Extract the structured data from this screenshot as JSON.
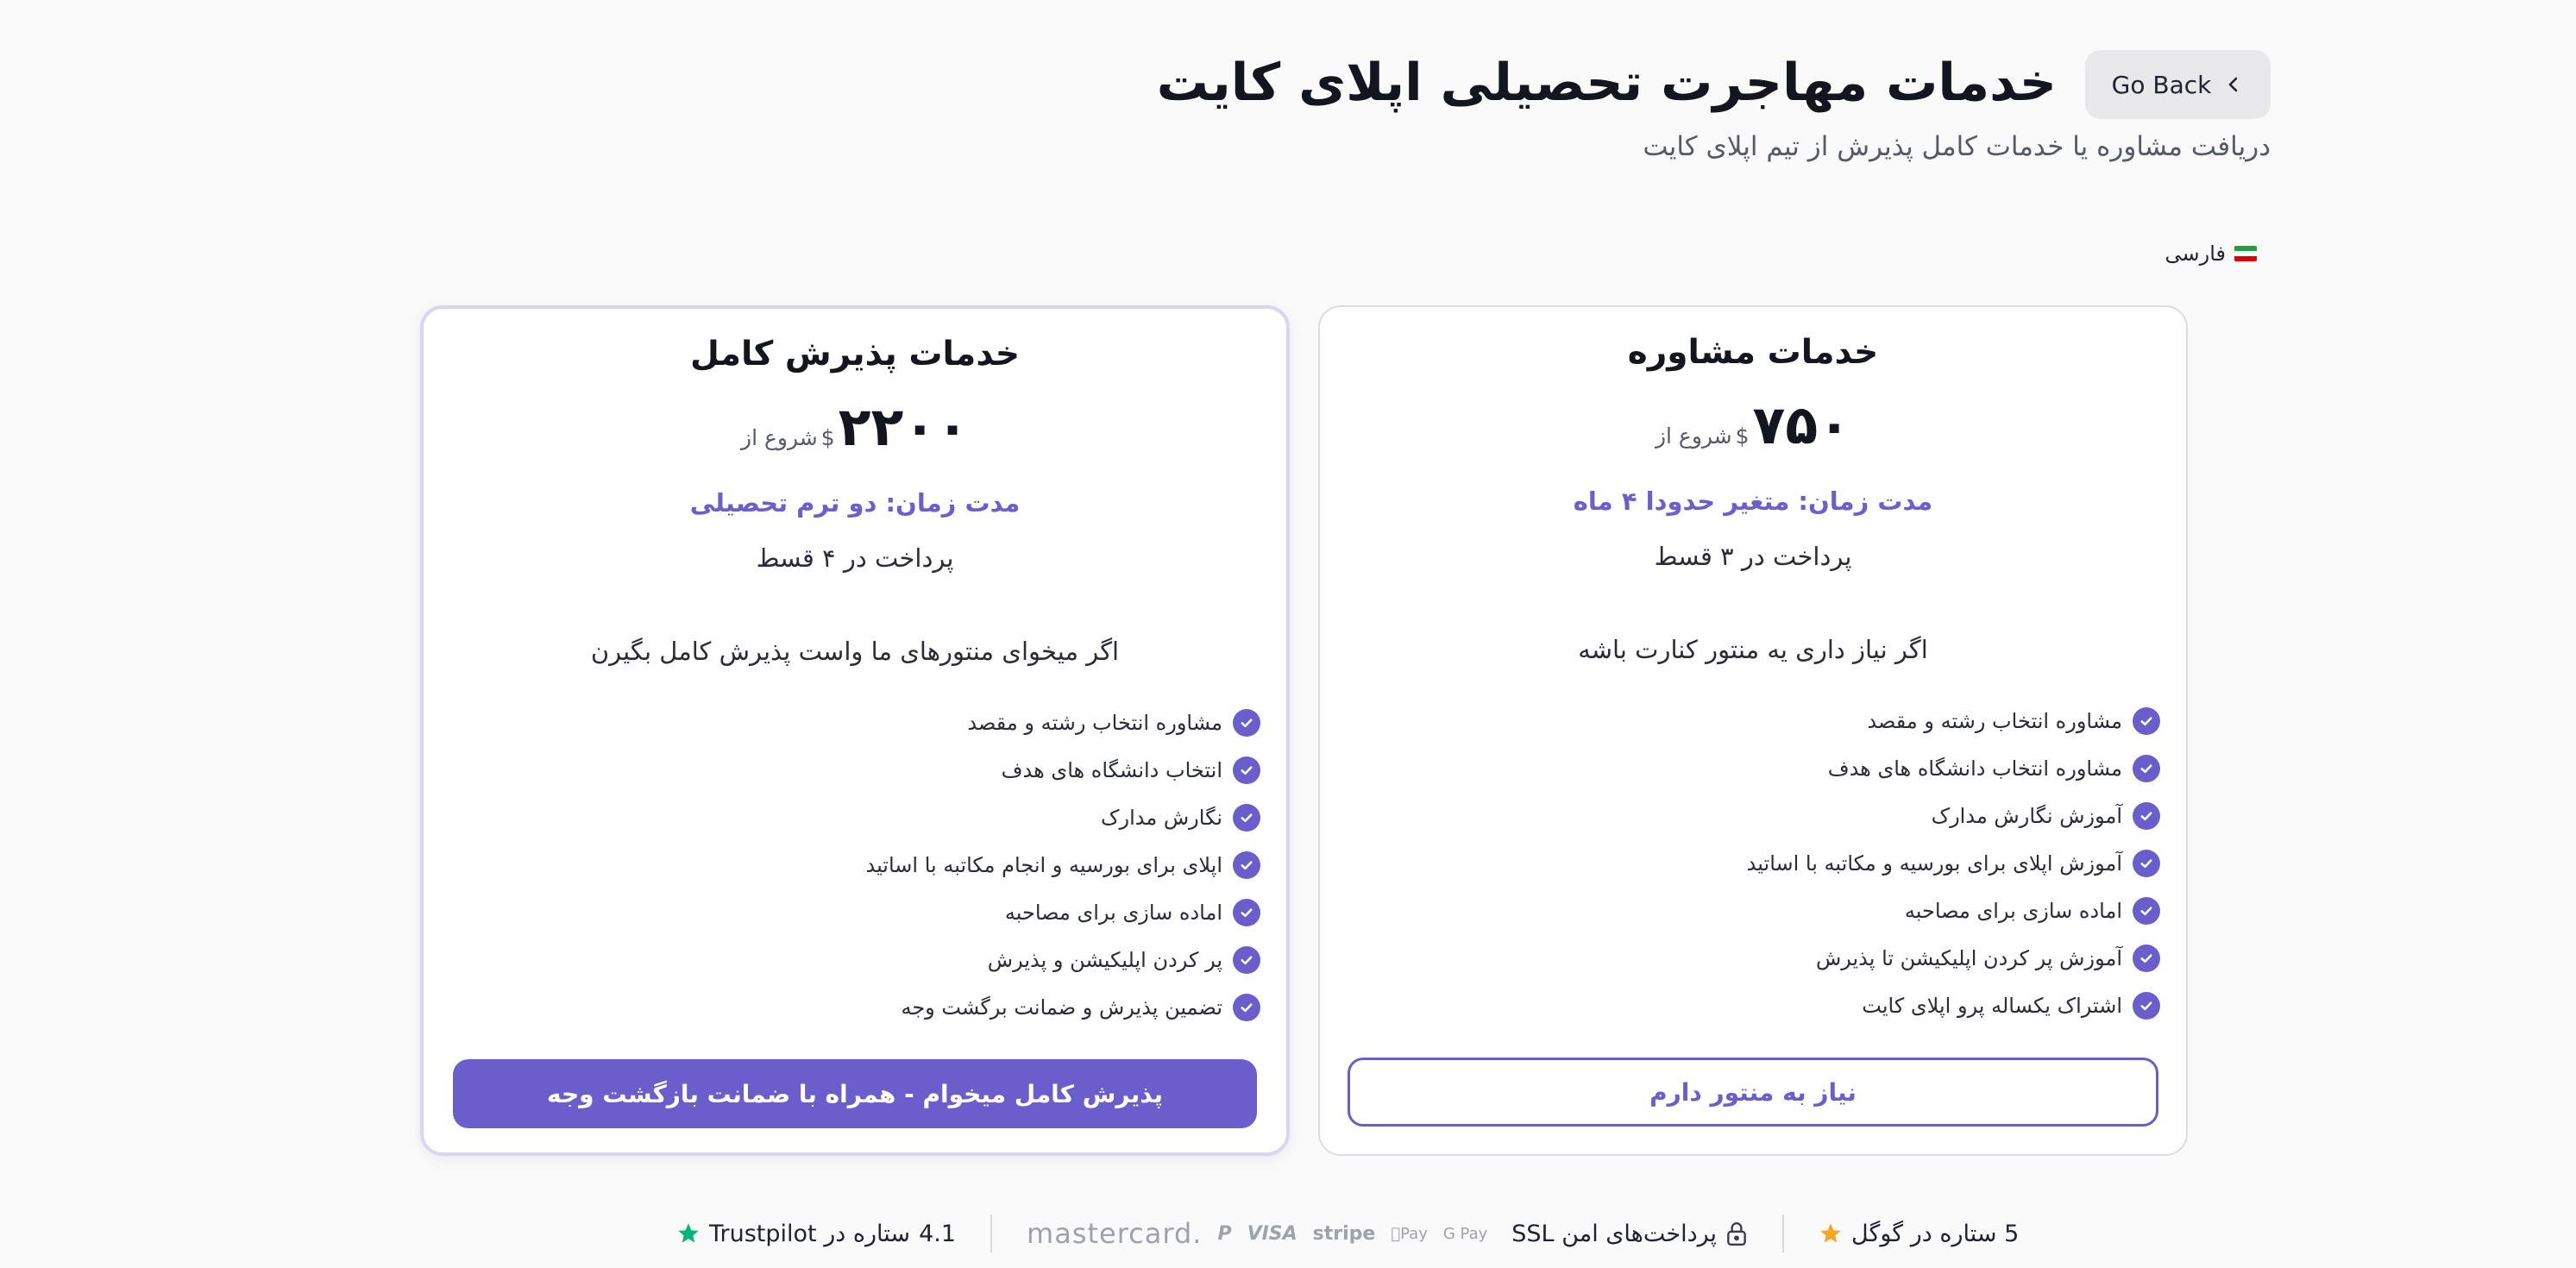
{
  "header": {
    "back_label": "Go Back",
    "title": "خدمات مهاجرت تحصیلی اپلای کایت",
    "subtitle": "دریافت مشاوره یا خدمات کامل پذیرش از تیم اپلای کایت",
    "language": "فارسی"
  },
  "cards": {
    "full": {
      "title": "خدمات پذیرش کامل",
      "price": "۲۲۰۰",
      "currency": "$",
      "from": "شروع از",
      "duration": "مدت زمان: دو ترم تحصیلی",
      "installments": "پرداخت در ۴ قسط",
      "tagline": "اگر میخوای منتورهای ما واست پذیرش کامل بگیرن",
      "features": [
        "مشاوره انتخاب رشته و مقصد",
        "انتخاب دانشگاه های هدف",
        "نگارش مدارک",
        "اپلای برای بورسیه و انجام مکاتبه با اساتید",
        "اماده سازی برای مصاحبه",
        "پر کردن اپلیکیشن و پذیرش",
        "تضمین پذیرش و ضمانت برگشت وجه"
      ],
      "cta": "پذیرش کامل میخوام - همراه با ضمانت بازگشت وجه"
    },
    "consult": {
      "title": "خدمات مشاوره",
      "price": "۷۵۰",
      "currency": "$",
      "from": "شروع از",
      "duration": "مدت زمان: متغیر حدودا ۴ ماه",
      "installments": "پرداخت در ۳ قسط",
      "tagline": "اگر نیاز داری یه منتور کنارت باشه",
      "features": [
        "مشاوره انتخاب رشته و مقصد",
        "مشاوره انتخاب دانشگاه های هدف",
        "آموزش نگارش مدارک",
        "آموزش اپلای برای بورسیه و مکاتبه با اساتید",
        "اماده سازی برای مصاحبه",
        "آموزش پر کردن اپلیکیشن تا پذیرش",
        "اشتراک یکساله پرو اپلای کایت"
      ],
      "cta": "نیاز به منتور دارم"
    }
  },
  "trust": {
    "google": "5 ستاره در گوگل",
    "secure": "پرداخت‌های امن SSL",
    "trustpilot_score": "4.1",
    "trustpilot_text": "ستاره در Trustpilot",
    "pay_logos": [
      "G Pay",
      "Pay",
      "stripe",
      "VISA",
      "P",
      "mastercard."
    ]
  },
  "colors": {
    "accent": "#6a5dcc",
    "star_google": "#f5a623",
    "star_trustpilot": "#00b67a"
  }
}
